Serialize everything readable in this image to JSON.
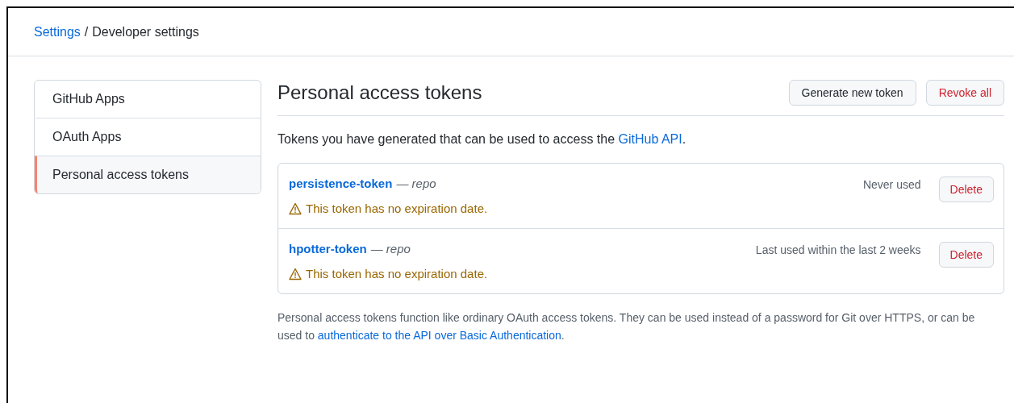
{
  "breadcrumb": {
    "link": "Settings",
    "separator": "/",
    "current": "Developer settings"
  },
  "sidebar": {
    "items": [
      {
        "label": "GitHub Apps",
        "selected": false
      },
      {
        "label": "OAuth Apps",
        "selected": false
      },
      {
        "label": "Personal access tokens",
        "selected": true
      }
    ]
  },
  "header": {
    "title": "Personal access tokens",
    "buttons": [
      {
        "label": "Generate new token",
        "kind": "default"
      },
      {
        "label": "Revoke all",
        "kind": "danger"
      }
    ]
  },
  "description": {
    "before": "Tokens you have generated that can be used to access the ",
    "link": "GitHub API",
    "after": "."
  },
  "tokens": [
    {
      "name": "persistence-token",
      "separator": "—",
      "scope": "repo",
      "usage": "Never used",
      "warning": "This token has no expiration date.",
      "button": "Delete"
    },
    {
      "name": "hpotter-token",
      "separator": "—",
      "scope": "repo",
      "usage": "Last used within the last 2 weeks",
      "warning": "This token has no expiration date.",
      "button": "Delete"
    }
  ],
  "note": {
    "before": "Personal access tokens function like ordinary OAuth access tokens. They can be used instead of a password for Git over HTTPS, or can be used to ",
    "link": "authenticate to the API over Basic Authentication",
    "after": "."
  }
}
